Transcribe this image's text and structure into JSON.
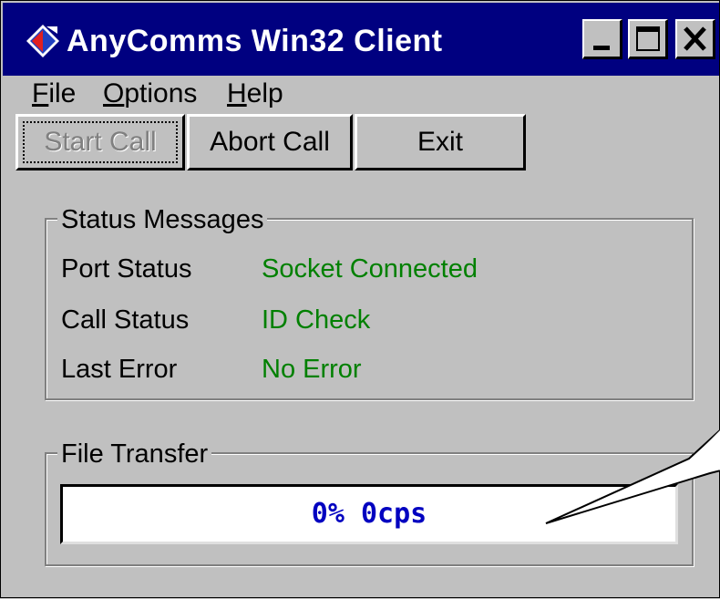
{
  "window": {
    "title": "AnyComms Win32 Client",
    "icon": "anycomms-app-icon"
  },
  "title_buttons": {
    "minimize_icon": "minimize-icon",
    "maximize_icon": "maximize-icon",
    "close_icon": "close-icon"
  },
  "menu": {
    "file": {
      "accel": "F",
      "rest": "ile"
    },
    "options": {
      "accel": "O",
      "rest": "ptions"
    },
    "help": {
      "accel": "H",
      "rest": "elp"
    }
  },
  "toolbar": {
    "start_call": "Start Call",
    "abort_call": "Abort Call",
    "exit": "Exit"
  },
  "status_messages": {
    "legend": "Status Messages",
    "rows": [
      {
        "label": "Port Status",
        "value": "Socket Connected"
      },
      {
        "label": "Call Status",
        "value": "ID Check"
      },
      {
        "label": "Last Error",
        "value": "No Error"
      }
    ]
  },
  "file_transfer": {
    "legend": "File Transfer",
    "progress_text": "0% 0cps",
    "progress_fraction": 0
  },
  "colors": {
    "titlebar": "#000080",
    "status_value": "#008000",
    "progress_text": "#0000c0"
  }
}
